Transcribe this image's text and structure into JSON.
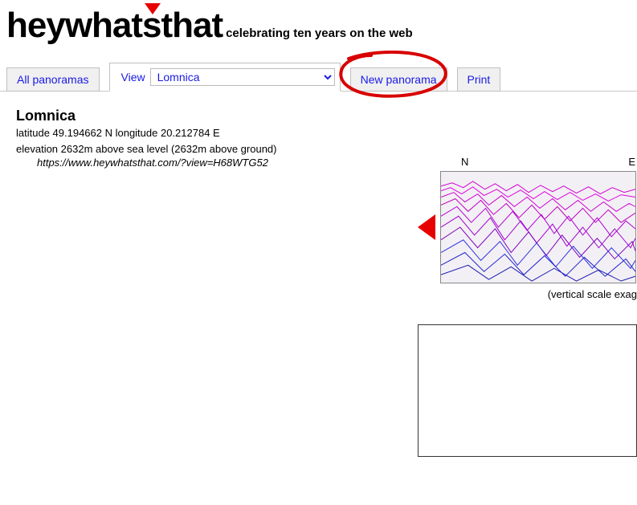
{
  "header": {
    "logo_text": "heywhatsthat",
    "tagline": "celebrating ten years on the web"
  },
  "tabs": {
    "all": "All panoramas",
    "view_label": "View",
    "view_selected": "Lomnica",
    "new": "New panorama",
    "print": "Print"
  },
  "place": {
    "name": "Lomnica",
    "coords": "latitude 49.194662 N longitude 20.212784 E",
    "elevation": "elevation 2632m above sea level (2632m above ground)",
    "url": "https://www.heywhatsthat.com/?view=H68WTG52"
  },
  "panorama": {
    "compass_n": "N",
    "compass_e": "E",
    "note": "(vertical scale exag"
  }
}
